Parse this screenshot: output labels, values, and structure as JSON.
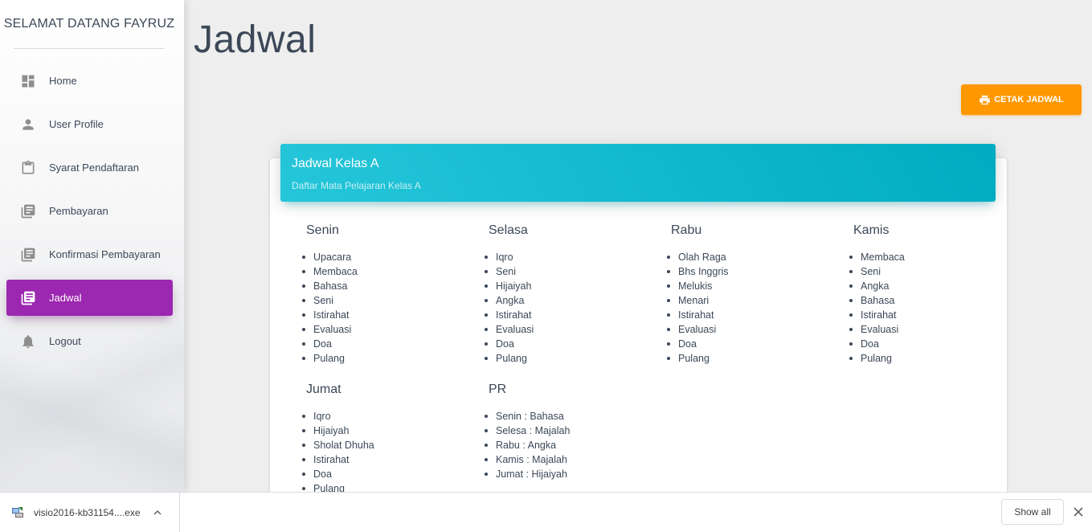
{
  "sidebar": {
    "brand": "SELAMAT DATANG FAYRUZ",
    "items": [
      {
        "label": "Home",
        "icon": "dashboard-icon",
        "active": false
      },
      {
        "label": "User Profile",
        "icon": "person-icon",
        "active": false
      },
      {
        "label": "Syarat Pendaftaran",
        "icon": "clipboard-icon",
        "active": false
      },
      {
        "label": "Pembayaran",
        "icon": "library-books-icon",
        "active": false
      },
      {
        "label": "Konfirmasi Pembayaran",
        "icon": "library-books-icon",
        "active": false
      },
      {
        "label": "Jadwal",
        "icon": "library-books-icon",
        "active": true
      },
      {
        "label": "Logout",
        "icon": "bell-icon",
        "active": false
      }
    ]
  },
  "main": {
    "title": "Jadwal",
    "print_button": "CETAK JADWAL",
    "card": {
      "title": "Jadwal Kelas A",
      "subtitle": "Daftar Mata Pelajaran Kelas A",
      "days": [
        {
          "name": "Senin",
          "items": [
            "Upacara",
            "Membaca",
            "Bahasa",
            "Seni",
            "Istirahat",
            "Evaluasi",
            "Doa",
            "Pulang"
          ]
        },
        {
          "name": "Selasa",
          "items": [
            "Iqro",
            "Seni",
            "Hijaiyah",
            "Angka",
            "Istirahat",
            "Evaluasi",
            "Doa",
            "Pulang"
          ]
        },
        {
          "name": "Rabu",
          "items": [
            "Olah Raga",
            "Bhs Inggris",
            "Melukis",
            "Menari",
            "Istirahat",
            "Evaluasi",
            "Doa",
            "Pulang"
          ]
        },
        {
          "name": "Kamis",
          "items": [
            "Membaca",
            "Seni",
            "Angka",
            "Bahasa",
            "Istirahat",
            "Evaluasi",
            "Doa",
            "Pulang"
          ]
        },
        {
          "name": "Jumat",
          "items": [
            "Iqro",
            "Hijaiyah",
            "Sholat Dhuha",
            "Istirahat",
            "Doa",
            "Pulang"
          ]
        },
        {
          "name": "PR",
          "items": [
            "Senin : Bahasa",
            "Selesa : Majalah",
            "Rabu : Angka",
            "Kamis : Majalah",
            "Jumat : Hijaiyah"
          ]
        }
      ]
    }
  },
  "download_bar": {
    "file_name": "visio2016-kb31154....exe",
    "show_all": "Show all"
  },
  "colors": {
    "active_nav": "#9c27b0",
    "print_button": "#ff9800",
    "card_header": "#00acc1"
  }
}
